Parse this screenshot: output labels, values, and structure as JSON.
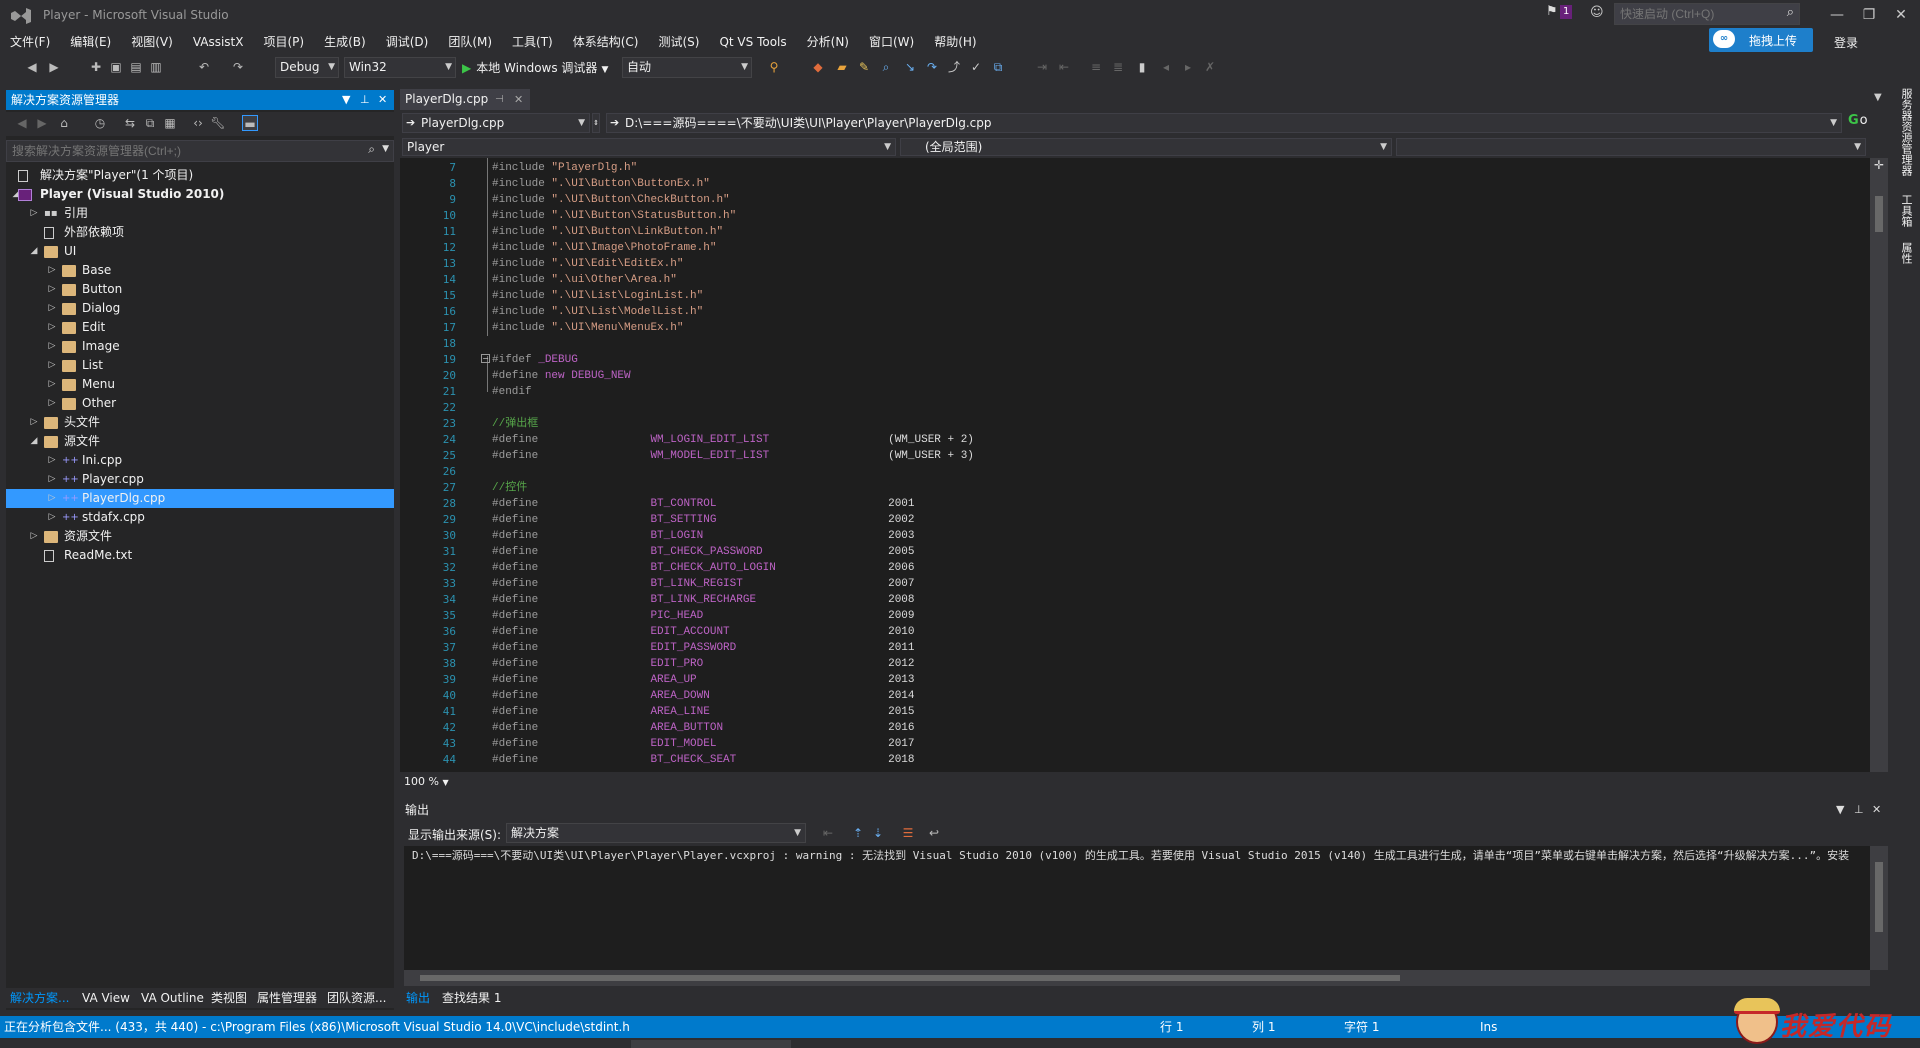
{
  "window": {
    "title": "Player - Microsoft Visual Studio",
    "notification_count": "1",
    "quick_launch_placeholder": "快速启动 (Ctrl+Q)",
    "upload_label": "拖拽上传",
    "login_label": "登录"
  },
  "menu": [
    "文件(F)",
    "编辑(E)",
    "视图(V)",
    "VAssistX",
    "项目(P)",
    "生成(B)",
    "调试(D)",
    "团队(M)",
    "工具(T)",
    "体系结构(C)",
    "测试(S)",
    "Qt VS Tools",
    "分析(N)",
    "窗口(W)",
    "帮助(H)"
  ],
  "toolbar": {
    "config": "Debug",
    "platform": "Win32",
    "debugger": "本地 Windows 调试器",
    "mode": "自动"
  },
  "solution_explorer": {
    "title": "解决方案资源管理器",
    "search_placeholder": "搜索解决方案资源管理器(Ctrl+;)",
    "tree": [
      {
        "label": "解决方案\"Player\"(1 个项目)",
        "depth": 0,
        "expander": "",
        "icon": "solution-icon"
      },
      {
        "label": "Player (Visual Studio 2010)",
        "depth": 0,
        "expander": "◢",
        "icon": "project-icon",
        "bold": true
      },
      {
        "label": "引用",
        "depth": 1,
        "expander": "▷",
        "icon": "references-icon"
      },
      {
        "label": "外部依赖项",
        "depth": 1,
        "expander": "",
        "icon": "external-deps-icon"
      },
      {
        "label": "UI",
        "depth": 1,
        "expander": "◢",
        "icon": "folder-icon"
      },
      {
        "label": "Base",
        "depth": 2,
        "expander": "▷",
        "icon": "folder-icon"
      },
      {
        "label": "Button",
        "depth": 2,
        "expander": "▷",
        "icon": "folder-icon"
      },
      {
        "label": "Dialog",
        "depth": 2,
        "expander": "▷",
        "icon": "folder-icon"
      },
      {
        "label": "Edit",
        "depth": 2,
        "expander": "▷",
        "icon": "folder-icon"
      },
      {
        "label": "Image",
        "depth": 2,
        "expander": "▷",
        "icon": "folder-icon"
      },
      {
        "label": "List",
        "depth": 2,
        "expander": "▷",
        "icon": "folder-icon"
      },
      {
        "label": "Menu",
        "depth": 2,
        "expander": "▷",
        "icon": "folder-icon"
      },
      {
        "label": "Other",
        "depth": 2,
        "expander": "▷",
        "icon": "folder-icon"
      },
      {
        "label": "头文件",
        "depth": 1,
        "expander": "▷",
        "icon": "folder-icon"
      },
      {
        "label": "源文件",
        "depth": 1,
        "expander": "◢",
        "icon": "folder-icon"
      },
      {
        "label": "Ini.cpp",
        "depth": 2,
        "expander": "▷",
        "icon": "cpp-file-icon"
      },
      {
        "label": "Player.cpp",
        "depth": 2,
        "expander": "▷",
        "icon": "cpp-file-icon"
      },
      {
        "label": "PlayerDlg.cpp",
        "depth": 2,
        "expander": "▷",
        "icon": "cpp-file-icon",
        "selected": true
      },
      {
        "label": "stdafx.cpp",
        "depth": 2,
        "expander": "▷",
        "icon": "cpp-file-icon"
      },
      {
        "label": "资源文件",
        "depth": 1,
        "expander": "▷",
        "icon": "folder-icon"
      },
      {
        "label": "ReadMe.txt",
        "depth": 1,
        "expander": "",
        "icon": "text-file-icon"
      }
    ],
    "bottom_tabs": [
      "解决方案...",
      "VA View",
      "VA Outline",
      "类视图",
      "属性管理器",
      "团队资源..."
    ]
  },
  "editor": {
    "tab_label": "PlayerDlg.cpp",
    "nav_file": "PlayerDlg.cpp",
    "nav_path": "D:\\===源码====\\不要动\\UI类\\UI\\Player\\Player\\PlayerDlg.cpp",
    "go_label": "Go",
    "scope_project": "Player",
    "scope_global": "(全局范围)",
    "zoom": "100 %",
    "lines": [
      {
        "n": "7",
        "pre": "#include ",
        "str": "\"PlayerDlg.h\""
      },
      {
        "n": "8",
        "pre": "#include ",
        "str": "\".\\UI\\Button\\ButtonEx.h\""
      },
      {
        "n": "9",
        "pre": "#include ",
        "str": "\".\\UI\\Button\\CheckButton.h\""
      },
      {
        "n": "10",
        "pre": "#include ",
        "str": "\".\\UI\\Button\\StatusButton.h\""
      },
      {
        "n": "11",
        "pre": "#include ",
        "str": "\".\\UI\\Button\\LinkButton.h\""
      },
      {
        "n": "12",
        "pre": "#include ",
        "str": "\".\\UI\\Image\\PhotoFrame.h\""
      },
      {
        "n": "13",
        "pre": "#include ",
        "str": "\".\\UI\\Edit\\EditEx.h\""
      },
      {
        "n": "14",
        "pre": "#include ",
        "str": "\".\\ui\\Other\\Area.h\""
      },
      {
        "n": "15",
        "pre": "#include ",
        "str": "\".\\UI\\List\\LoginList.h\""
      },
      {
        "n": "16",
        "pre": "#include ",
        "str": "\".\\UI\\List\\ModelList.h\""
      },
      {
        "n": "17",
        "pre": "#include ",
        "str": "\".\\UI\\Menu\\MenuEx.h\""
      },
      {
        "n": "18",
        "pre": ""
      },
      {
        "n": "19",
        "pre": "#ifdef ",
        "mac": "_DEBUG"
      },
      {
        "n": "20",
        "pre": "#define ",
        "kw": "new",
        "mac": " DEBUG_NEW"
      },
      {
        "n": "21",
        "pre": "#endif"
      },
      {
        "n": "22",
        "pre": ""
      },
      {
        "n": "23",
        "cmt": "//弹出框"
      },
      {
        "n": "24",
        "pre": "#define                 ",
        "mac": "WM_LOGIN_EDIT_LIST",
        "pad": "                  ",
        "val": "(WM_USER + 2)"
      },
      {
        "n": "25",
        "pre": "#define                 ",
        "mac": "WM_MODEL_EDIT_LIST",
        "pad": "                  ",
        "val": "(WM_USER + 3)"
      },
      {
        "n": "26",
        "pre": ""
      },
      {
        "n": "27",
        "cmt": "//控件"
      },
      {
        "n": "28",
        "pre": "#define                 ",
        "mac": "BT_CONTROL",
        "pad": "                          ",
        "val": "2001"
      },
      {
        "n": "29",
        "pre": "#define                 ",
        "mac": "BT_SETTING",
        "pad": "                          ",
        "val": "2002"
      },
      {
        "n": "30",
        "pre": "#define                 ",
        "mac": "BT_LOGIN",
        "pad": "                            ",
        "val": "2003"
      },
      {
        "n": "31",
        "pre": "#define                 ",
        "mac": "BT_CHECK_PASSWORD",
        "pad": "                   ",
        "val": "2005"
      },
      {
        "n": "32",
        "pre": "#define                 ",
        "mac": "BT_CHECK_AUTO_LOGIN",
        "pad": "                 ",
        "val": "2006"
      },
      {
        "n": "33",
        "pre": "#define                 ",
        "mac": "BT_LINK_REGIST",
        "pad": "                      ",
        "val": "2007"
      },
      {
        "n": "34",
        "pre": "#define                 ",
        "mac": "BT_LINK_RECHARGE",
        "pad": "                    ",
        "val": "2008"
      },
      {
        "n": "35",
        "pre": "#define                 ",
        "mac": "PIC_HEAD",
        "pad": "                            ",
        "val": "2009"
      },
      {
        "n": "36",
        "pre": "#define                 ",
        "mac": "EDIT_ACCOUNT",
        "pad": "                        ",
        "val": "2010"
      },
      {
        "n": "37",
        "pre": "#define                 ",
        "mac": "EDIT_PASSWORD",
        "pad": "                       ",
        "val": "2011"
      },
      {
        "n": "38",
        "pre": "#define                 ",
        "mac": "EDIT_PRO",
        "pad": "                            ",
        "val": "2012"
      },
      {
        "n": "39",
        "pre": "#define                 ",
        "mac": "AREA_UP",
        "pad": "                             ",
        "val": "2013"
      },
      {
        "n": "40",
        "pre": "#define                 ",
        "mac": "AREA_DOWN",
        "pad": "                           ",
        "val": "2014"
      },
      {
        "n": "41",
        "pre": "#define                 ",
        "mac": "AREA_LINE",
        "pad": "                           ",
        "val": "2015"
      },
      {
        "n": "42",
        "pre": "#define                 ",
        "mac": "AREA_BUTTON",
        "pad": "                         ",
        "val": "2016"
      },
      {
        "n": "43",
        "pre": "#define                 ",
        "mac": "EDIT_MODEL",
        "pad": "                          ",
        "val": "2017"
      },
      {
        "n": "44",
        "pre": "#define                 ",
        "mac": "BT_CHECK_SEAT",
        "pad": "                       ",
        "val": "2018"
      }
    ]
  },
  "output": {
    "title": "输出",
    "source_label": "显示输出来源(S):",
    "source_value": "解决方案",
    "text": "D:\\===源码===\\不要动\\UI类\\UI\\Player\\Player\\Player.vcxproj : warning  : 无法找到 Visual Studio 2010 (v100) 的生成工具。若要使用 Visual Studio 2015 (v140) 生成工具进行生成，请单击“项目”菜单或右键单击解决方案，然后选择“升级解决方案...”。安装",
    "tabs": [
      "输出",
      "查找结果 1"
    ]
  },
  "right_rail": [
    "服务器资源管理器",
    "工具箱",
    "属性"
  ],
  "status": {
    "message": "正在分析包含文件... (433，共 440) - c:\\Program Files (x86)\\Microsoft Visual Studio 14.0\\VC\\include\\stdint.h",
    "row": "行 1",
    "col": "列 1",
    "char": "字符 1",
    "ins": "Ins",
    "watermark": "我爱代码"
  },
  "colors": {
    "accent": "#007acc",
    "selection": "#3399ff",
    "background": "#2d2d30",
    "editor_bg": "#1e1e1e",
    "preprocessor": "#9b9b9b",
    "string": "#d69d85",
    "macro": "#bd63c5",
    "comment": "#57a64a",
    "line_number": "#2b91af"
  }
}
